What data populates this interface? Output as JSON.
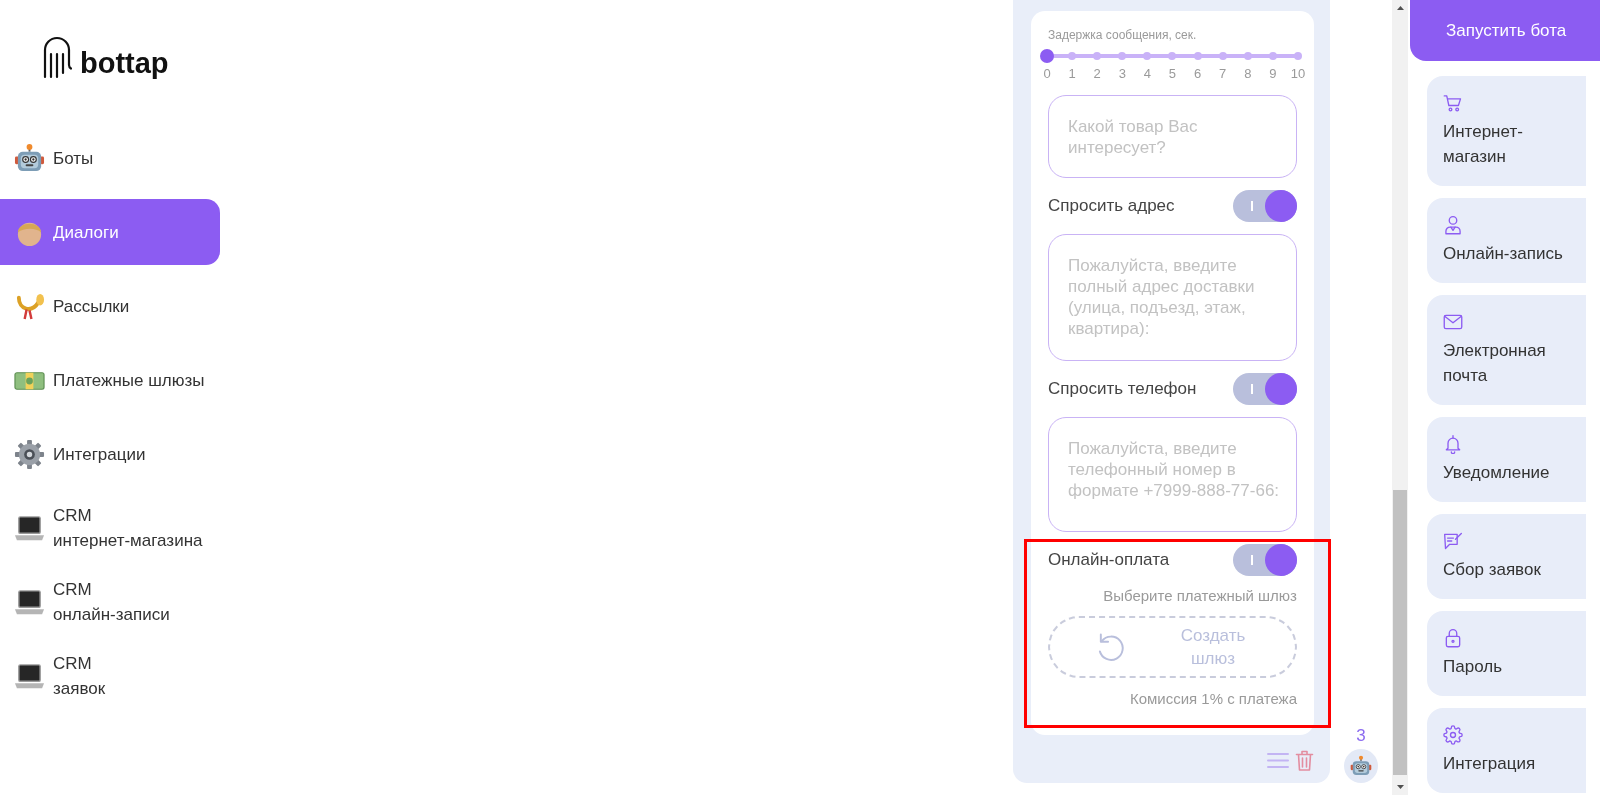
{
  "logo": {
    "text": "bottap"
  },
  "sidebar": {
    "items": [
      {
        "kind": "robot",
        "label": "Боты",
        "selected": false
      },
      {
        "kind": "person",
        "label": "Диалоги",
        "selected": true
      },
      {
        "kind": "horn",
        "label": "Рассылки",
        "selected": false
      },
      {
        "kind": "banknote",
        "label": "Платежные шлюзы",
        "selected": false
      },
      {
        "kind": "gear",
        "label": "Интеграции",
        "selected": false
      },
      {
        "kind": "laptop",
        "label": "CRM\nинтернет-магазина",
        "selected": false
      },
      {
        "kind": "laptop",
        "label": "CRM\nонлайн-записи",
        "selected": false
      },
      {
        "kind": "laptop",
        "label": "CRM\nзаявок",
        "selected": false
      }
    ]
  },
  "editor": {
    "delay": {
      "label": "Задержка сообщения, сек.",
      "ticks": [
        "0",
        "1",
        "2",
        "3",
        "4",
        "5",
        "6",
        "7",
        "8",
        "9",
        "10"
      ],
      "level": 0
    },
    "items": [
      {
        "kind": "textarea",
        "placeholder": "Какой товар Вас интересует?"
      },
      {
        "kind": "toggle",
        "label": "Спросить адрес",
        "on": true
      },
      {
        "kind": "textarea",
        "placeholder": "Пожалуйста, введите полный адрес доставки (улица, подъезд, этаж, квартира):"
      },
      {
        "kind": "toggle",
        "label": "Спросить телефон",
        "on": true
      },
      {
        "kind": "textarea",
        "placeholder": "Пожалуйста, введите телефонный номер в формате +7999-888-77-66:"
      }
    ],
    "payment": {
      "highlighted": true,
      "label": "Онлайн-оплата",
      "on": true,
      "hint": "Выберите платежный шлюз",
      "create_button": "Создать шлюз",
      "commission": "Комиссия 1% с платежа"
    }
  },
  "bot_count": "3",
  "launch_button": "Запустить бота",
  "blocks": [
    {
      "kind": "cart",
      "label": "Интернет-магазин"
    },
    {
      "kind": "person",
      "label": "Онлайн-запись"
    },
    {
      "kind": "mail",
      "label": "Электронная почта"
    },
    {
      "kind": "bell",
      "label": "Уведомление"
    },
    {
      "kind": "form",
      "label": "Сбор заявок"
    },
    {
      "kind": "lock",
      "label": "Пароль"
    },
    {
      "kind": "gear",
      "label": "Интеграция"
    }
  ]
}
